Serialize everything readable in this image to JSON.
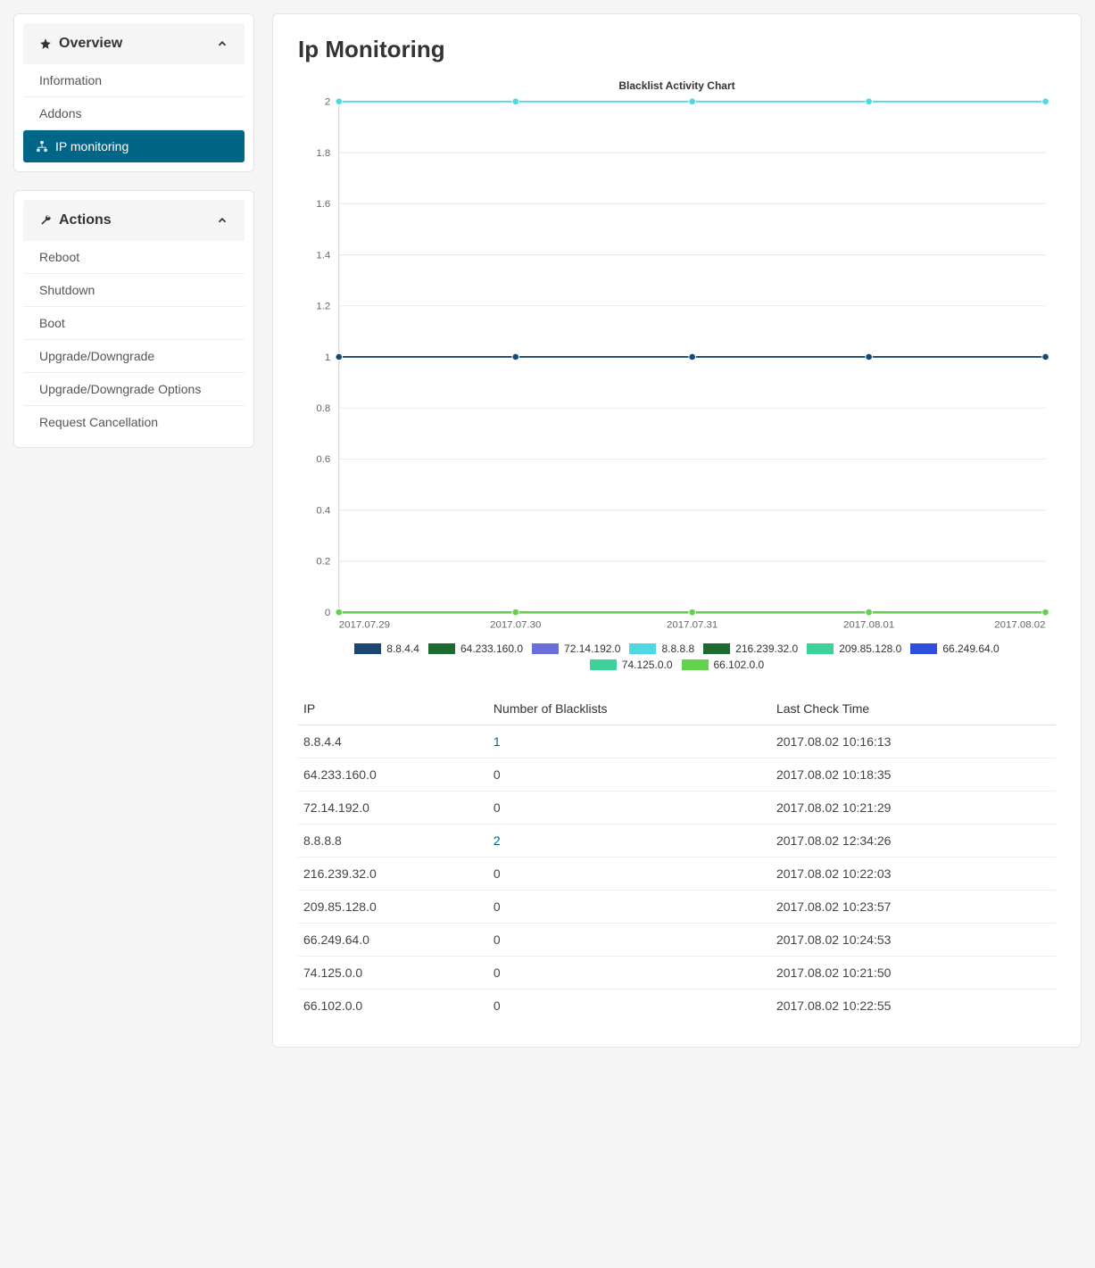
{
  "sidebar": {
    "overview": {
      "title": "Overview",
      "items": [
        {
          "label": "Information",
          "active": false
        },
        {
          "label": "Addons",
          "active": false
        },
        {
          "label": "IP monitoring",
          "active": true
        }
      ]
    },
    "actions": {
      "title": "Actions",
      "items": [
        {
          "label": "Reboot"
        },
        {
          "label": "Shutdown"
        },
        {
          "label": "Boot"
        },
        {
          "label": "Upgrade/Downgrade"
        },
        {
          "label": "Upgrade/Downgrade Options"
        },
        {
          "label": "Request Cancellation"
        }
      ]
    }
  },
  "main": {
    "title": "Ip Monitoring",
    "chart_title": "Blacklist Activity Chart",
    "table": {
      "headers": [
        "IP",
        "Number of Blacklists",
        "Last Check Time"
      ],
      "rows": [
        {
          "ip": "8.8.4.4",
          "count": "1",
          "link": true,
          "time": "2017.08.02 10:16:13"
        },
        {
          "ip": "64.233.160.0",
          "count": "0",
          "link": false,
          "time": "2017.08.02 10:18:35"
        },
        {
          "ip": "72.14.192.0",
          "count": "0",
          "link": false,
          "time": "2017.08.02 10:21:29"
        },
        {
          "ip": "8.8.8.8",
          "count": "2",
          "link": true,
          "time": "2017.08.02 12:34:26"
        },
        {
          "ip": "216.239.32.0",
          "count": "0",
          "link": false,
          "time": "2017.08.02 10:22:03"
        },
        {
          "ip": "209.85.128.0",
          "count": "0",
          "link": false,
          "time": "2017.08.02 10:23:57"
        },
        {
          "ip": "66.249.64.0",
          "count": "0",
          "link": false,
          "time": "2017.08.02 10:24:53"
        },
        {
          "ip": "74.125.0.0",
          "count": "0",
          "link": false,
          "time": "2017.08.02 10:21:50"
        },
        {
          "ip": "66.102.0.0",
          "count": "0",
          "link": false,
          "time": "2017.08.02 10:22:55"
        }
      ]
    }
  },
  "chart_data": {
    "type": "line",
    "title": "Blacklist Activity Chart",
    "xlabel": "",
    "ylabel": "",
    "ylim": [
      0,
      2
    ],
    "yticks": [
      0,
      0.2,
      0.4,
      0.6,
      0.8,
      1.0,
      1.2,
      1.4,
      1.6,
      1.8,
      2.0
    ],
    "categories": [
      "2017.07.29",
      "2017.07.30",
      "2017.07.31",
      "2017.08.01",
      "2017.08.02"
    ],
    "series": [
      {
        "name": "8.8.4.4",
        "color": "#1b4772",
        "values": [
          1,
          1,
          1,
          1,
          1
        ]
      },
      {
        "name": "64.233.160.0",
        "color": "#1e6b2f",
        "values": [
          0,
          0,
          0,
          0,
          0
        ]
      },
      {
        "name": "72.14.192.0",
        "color": "#6a6edc",
        "values": [
          0,
          0,
          0,
          0,
          0
        ]
      },
      {
        "name": "8.8.8.8",
        "color": "#4fd8e0",
        "values": [
          2,
          2,
          2,
          2,
          2
        ]
      },
      {
        "name": "216.239.32.0",
        "color": "#1e6b2f",
        "values": [
          0,
          0,
          0,
          0,
          0
        ]
      },
      {
        "name": "209.85.128.0",
        "color": "#3fd19a",
        "values": [
          0,
          0,
          0,
          0,
          0
        ]
      },
      {
        "name": "66.249.64.0",
        "color": "#2f4ee0",
        "values": [
          0,
          0,
          0,
          0,
          0
        ]
      },
      {
        "name": "74.125.0.0",
        "color": "#3fd19a",
        "values": [
          0,
          0,
          0,
          0,
          0
        ]
      },
      {
        "name": "66.102.0.0",
        "color": "#65d24e",
        "values": [
          0,
          0,
          0,
          0,
          0
        ]
      }
    ]
  }
}
